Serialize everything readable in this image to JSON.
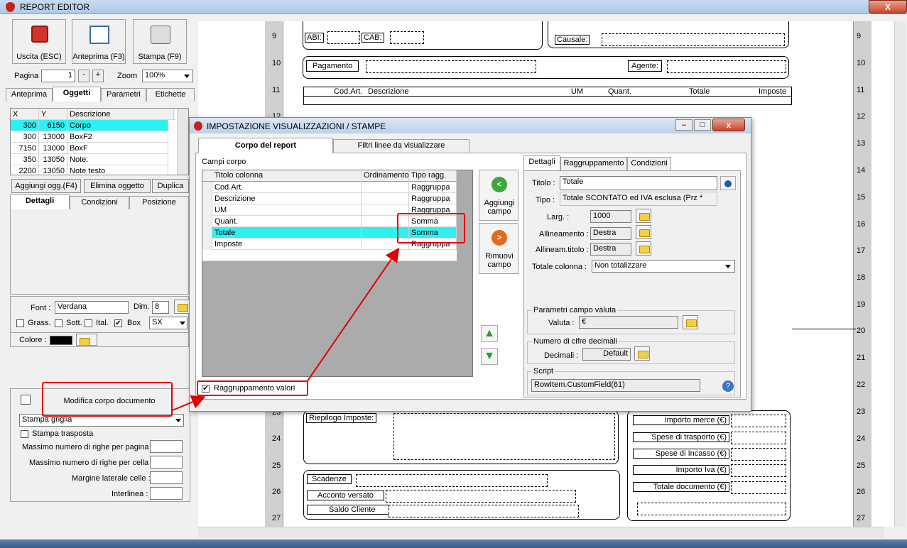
{
  "app": {
    "title": "REPORT EDITOR",
    "close": "X"
  },
  "toolbar": {
    "exit": "Uscita (ESC)",
    "preview": "Anteprima (F3)",
    "print": "Stampa (F9)"
  },
  "paging": {
    "page_label": "Pagina",
    "page_value": "1",
    "minus": "-",
    "plus": "+",
    "zoom_label": "Zoom",
    "zoom_value": "100%"
  },
  "left_tabs": [
    "Anteprima",
    "Oggetti",
    "Parametri",
    "Etichette"
  ],
  "objects": {
    "headers": [
      "X",
      "Y",
      "Descrizione"
    ],
    "rows": [
      {
        "x": "300",
        "y": "6150",
        "d": "Corpo"
      },
      {
        "x": "300",
        "y": "13000",
        "d": "BoxF2"
      },
      {
        "x": "7150",
        "y": "13000",
        "d": "BoxF"
      },
      {
        "x": "350",
        "y": "13050",
        "d": "Note:"
      },
      {
        "x": "2200",
        "y": "13050",
        "d": "Note testo"
      }
    ]
  },
  "obj_buttons": {
    "add": "Aggiungi ogg.(F4)",
    "delete": "Elimina oggetto",
    "dup": "Duplica"
  },
  "detail_tabs": [
    "Dettagli",
    "Condizioni",
    "Posizione"
  ],
  "font": {
    "label": "Font :",
    "value": "Verdana",
    "dim_label": "Dim.",
    "dim_value": "8",
    "bold": "Grass.",
    "under": "Sott.",
    "ital": "Ital.",
    "box": "Box",
    "align": "SX",
    "color_label": "Colore :"
  },
  "bottom": {
    "edit_body": "Modifica corpo documento",
    "print_grid": "Stampa griglia",
    "print_transposed": "Stampa trasposta",
    "max_rows_page": "Massimo numero di righe per pagina :",
    "max_rows_cell": "Massimo numero di righe per cella :",
    "side_margin": "Margine laterale celle :",
    "line_spacing": "Interlinea :"
  },
  "report": {
    "ruler_left": [
      "9",
      "10",
      "11",
      "12",
      "23",
      "24",
      "25",
      "26",
      "27"
    ],
    "ruler_right": [
      "9",
      "10",
      "11",
      "12",
      "13",
      "14",
      "15",
      "16",
      "17",
      "18",
      "19",
      "20",
      "21",
      "22",
      "23",
      "24",
      "25",
      "26",
      "27"
    ],
    "abi": "ABI:",
    "cab": "CAB:",
    "causale": "Causale:",
    "pagamento": "Pagamento",
    "agente": "Agente:",
    "cols": [
      "Cod.Art.",
      "Descrizione",
      "UM",
      "Quant.",
      "Totale",
      "Imposte"
    ],
    "riepilogo": "Riepilogo Imposte:",
    "scadenze": "Scadenze",
    "acconto": "Acconto versato",
    "saldo": "Saldo Cliente",
    "totals": [
      "Importo merce (€)",
      "Spese di trasporto (€)",
      "Spese di Incasso (€)",
      "Importo Iva (€)",
      "Totale documento (€)"
    ]
  },
  "dialog": {
    "title": "IMPOSTAZIONE VISUALIZZAZIONI / STAMPE",
    "tabs": [
      "Corpo del report",
      "Filtri linee da visualizzare"
    ],
    "campi_label": "Campi corpo",
    "headers": [
      "Titolo colonna",
      "Ordinamento",
      "Tipo ragg."
    ],
    "rows": [
      {
        "t": "Cod.Art.",
        "o": "",
        "r": "Raggruppa"
      },
      {
        "t": "Descrizione",
        "o": "",
        "r": "Raggruppa"
      },
      {
        "t": "UM",
        "o": "",
        "r": "Raggruppa"
      },
      {
        "t": "Quant.",
        "o": "",
        "r": "Somma"
      },
      {
        "t": "Totale",
        "o": "",
        "r": "Somma"
      },
      {
        "t": "Imposte",
        "o": "",
        "r": "Raggruppa"
      }
    ],
    "add_field": "Aggiungi campo",
    "remove_field": "Rimuovi campo",
    "group_values": "Raggruppamento valori",
    "right_tabs": [
      "Dettagli",
      "Raggruppamento",
      "Condizioni"
    ],
    "titolo_label": "Titolo :",
    "titolo_value": "Totale",
    "tipo_label": "Tipo :",
    "tipo_value": "Totale SCONTATO ed IVA esclusa (Prz * ",
    "larg_label": "Larg. :",
    "larg_value": "1000",
    "allin_label": "Allineamento :",
    "allin_value": "Destra",
    "allin_t_label": "Allineam.titolo :",
    "allin_t_value": "Destra",
    "tot_col_label": "Totale colonna :",
    "tot_col_value": "Non totalizzare",
    "currency_group": "Parametri campo valuta",
    "valuta_label": "Valuta :",
    "valuta_value": "€",
    "decimals_group": "Numero di cifre decimali",
    "decimals_label": "Decimali :",
    "decimals_value": "Default",
    "script_group": "Script",
    "script_value": "RowItem.CustomField(61)"
  }
}
